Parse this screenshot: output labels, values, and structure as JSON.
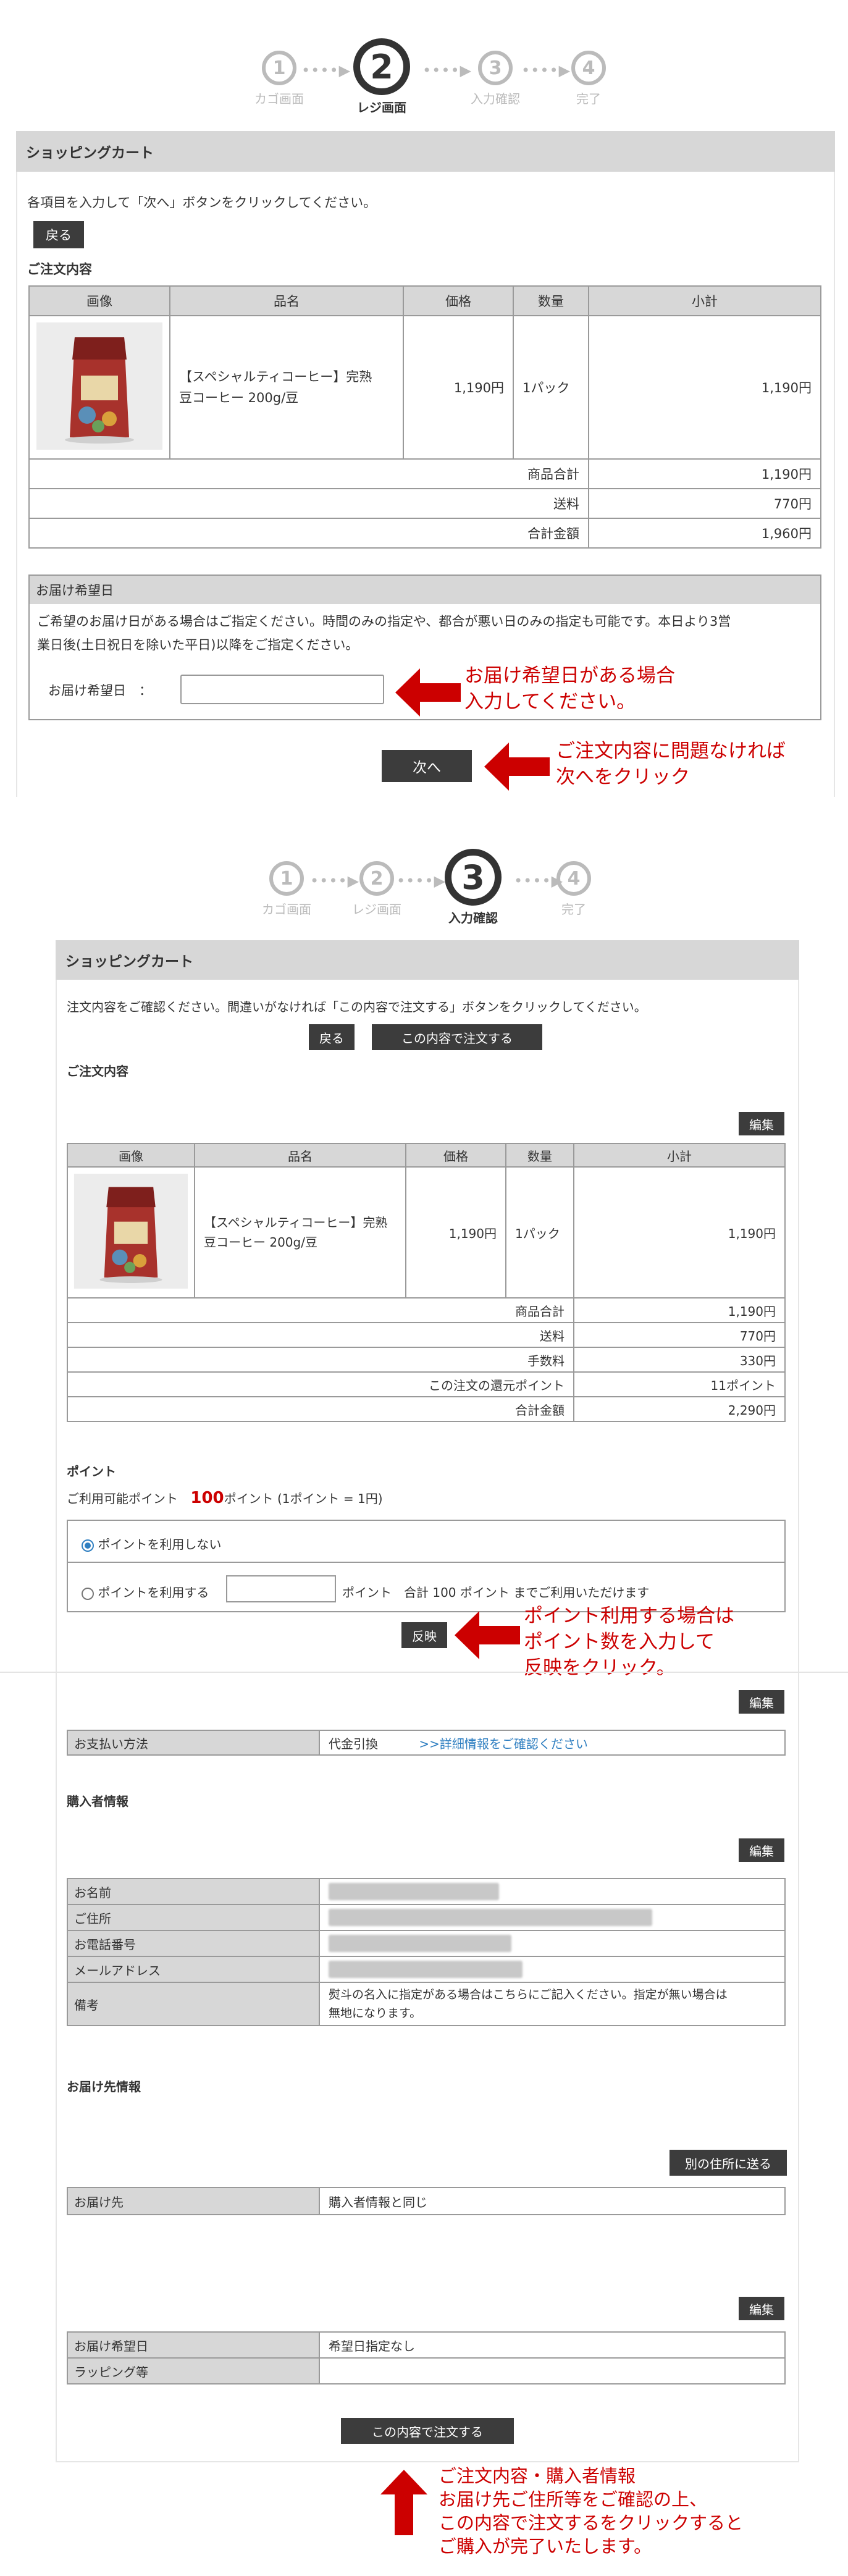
{
  "steps_top": {
    "items": [
      {
        "num": "1",
        "label": "カゴ画面"
      },
      {
        "num": "2",
        "label": "レジ画面"
      },
      {
        "num": "3",
        "label": "入力確認"
      },
      {
        "num": "4",
        "label": "完了"
      }
    ],
    "dots": "••••"
  },
  "cart1": {
    "title": "ショッピングカート",
    "instruction": "各項目を入力して「次へ」ボタンをクリックしてください。",
    "back_label": "戻る",
    "order_heading": "ご注文内容",
    "headers": [
      "画像",
      "品名",
      "価格",
      "数量",
      "小計"
    ],
    "item": {
      "name_line1": "【スペシャルティコーヒー】完熟",
      "name_line2": "豆コーヒー 200g/豆",
      "price": "1,190円",
      "qty": "1パック",
      "subtotal": "1,190円"
    },
    "totals": [
      {
        "label": "商品合計",
        "value": "1,190円"
      },
      {
        "label": "送料",
        "value": "770円"
      },
      {
        "label": "合計金額",
        "value": "1,960円"
      }
    ],
    "delivery_heading": "お届け希望日",
    "delivery_note_1": "ご希望のお届け日がある場合はご指定ください。時間のみの指定や、都合が悪い日のみの指定も可能です。本日より3営",
    "delivery_note_2": "業日後(土日祝日を除いた平日)以降をご指定ください。",
    "delivery_label": "お届け希望日　：",
    "delivery_value": "",
    "next_label": "次へ",
    "annot_date_1": "お届け希望日がある場合",
    "annot_date_2": "入力してください。",
    "annot_next_1": "ご注文内容に問題なければ",
    "annot_next_2": "次へをクリック"
  },
  "cart2": {
    "title": "ショッピングカート",
    "instruction": "注文内容をご確認ください。間違いがなければ「この内容で注文する」ボタンをクリックしてください。",
    "back_label": "戻る",
    "order_label": "この内容で注文する",
    "order_heading": "ご注文内容",
    "edit_label": "編集",
    "headers": [
      "画像",
      "品名",
      "価格",
      "数量",
      "小計"
    ],
    "item": {
      "name_line1": "【スペシャルティコーヒー】完熟",
      "name_line2": "豆コーヒー 200g/豆",
      "price": "1,190円",
      "qty": "1パック",
      "subtotal": "1,190円"
    },
    "totals": [
      {
        "label": "商品合計",
        "value": "1,190円"
      },
      {
        "label": "送料",
        "value": "770円"
      },
      {
        "label": "手数料",
        "value": "330円"
      },
      {
        "label": "この注文の還元ポイント",
        "value": "11ポイント"
      },
      {
        "label": "合計金額",
        "value": "2,290円"
      }
    ],
    "points_heading": "ポイント",
    "points_available_prefix": "ご利用可能ポイント",
    "points_available_value": "100",
    "points_available_suffix": "ポイント (1ポイント = 1円)",
    "points_opt_none": "ポイントを利用しない",
    "points_opt_use": "ポイントを利用する",
    "points_unit": "ポイント",
    "points_limit": "合計 100 ポイント までご利用いただけます",
    "reflect_label": "反映",
    "annot_points_1": "ポイント利用する場合は",
    "annot_points_2": "ポイント数を入力して",
    "annot_points_3": "反映をクリック。",
    "payment_label": "お支払い方法",
    "payment_value": "代金引換",
    "payment_link": ">>詳細情報をご確認ください",
    "buyer_heading": "購入者情報",
    "buyer_rows": [
      "お名前",
      "ご住所",
      "お電話番号",
      "メールアドレス",
      "備考"
    ],
    "buyer_note_1": "熨斗の名入に指定がある場合はこちらにご記入ください。指定が無い場合は",
    "buyer_note_2": "無地になります。",
    "ship_heading": "お届け先情報",
    "other_addr_label": "別の住所に送る",
    "ship_label": "お届け先",
    "ship_value": "購入者情報と同じ",
    "date_label": "お届け希望日",
    "date_value": "希望日指定なし",
    "wrap_label": "ラッピング等",
    "wrap_value": "",
    "final_order_label": "この内容で注文する",
    "annot_final_1": "ご注文内容・購入者情報",
    "annot_final_2": "お届け先ご住所等をご確認の上、",
    "annot_final_3": "この内容で注文するをクリックすると",
    "annot_final_4": "ご購入が完了いたします。"
  },
  "colors": {
    "annotation": "#cc0000",
    "header_bg": "#d7d7d7",
    "button_bg": "#3c3c3c",
    "link": "#2f7fc1"
  }
}
